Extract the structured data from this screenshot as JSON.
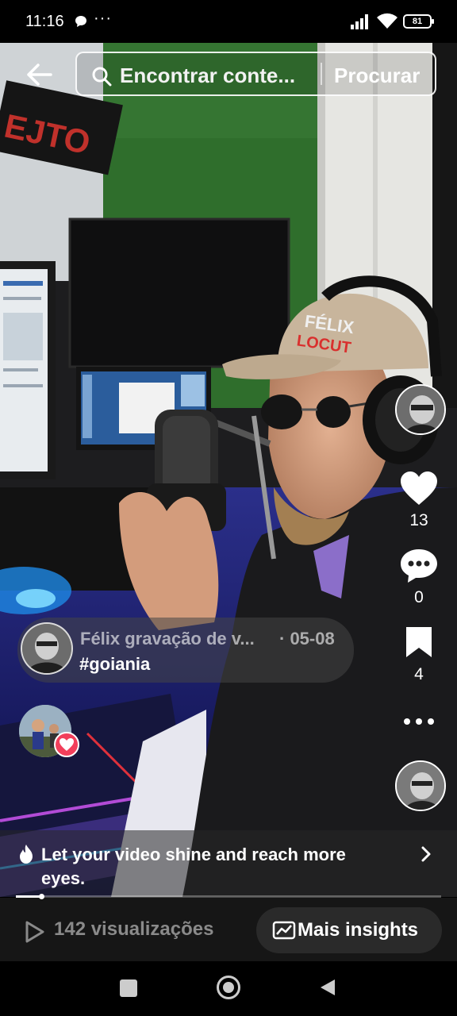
{
  "status_bar": {
    "time": "11:16",
    "more": "···",
    "battery": "81"
  },
  "header": {
    "search_placeholder": "Encontrar conte...",
    "search_button": "Procurar"
  },
  "actions": {
    "likes": "13",
    "comments": "0",
    "saves": "4"
  },
  "post": {
    "author": "Félix gravação de v...",
    "date": "· 05-08",
    "hashtag": "#goiania"
  },
  "promo": {
    "text": "Let your video shine and reach more eyes."
  },
  "progress": {
    "fraction": 0.06
  },
  "bottom": {
    "views": "142 visualizações",
    "insights": "Mais insights"
  },
  "colors": {
    "heart_badge": "#f23f5b",
    "accent": "#ffffff"
  }
}
